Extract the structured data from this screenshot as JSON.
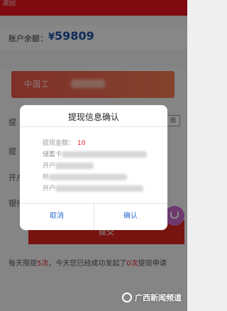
{
  "header": {
    "back_label": "返回"
  },
  "balance": {
    "label": "账户余额：",
    "currency": "¥",
    "amount": "59809"
  },
  "bank_card": {
    "bank_name": "中国工"
  },
  "form": {
    "label_1": "提",
    "label_2": "提",
    "label_3": "开户",
    "label_4": "银行",
    "badge": "图",
    "submit_label": "提交"
  },
  "limit_note": {
    "part1": "每天限提",
    "count_limit": "5次",
    "part2": "，今天您已经成功发起了",
    "count_done": "0次",
    "part3": "提现申请"
  },
  "dialog": {
    "title": "提现信息确认",
    "amount_label": "提现金额：",
    "amount_value": "10",
    "holder_label": "储蓄卡",
    "account_label": "开户",
    "branch_label": "所",
    "bank_label": "开户",
    "cancel_label": "取消",
    "confirm_label": "确认"
  },
  "watermark": {
    "text": "广西新闻频道"
  },
  "colors": {
    "brand_red": "#e8141e",
    "link_blue": "#2d6fd2",
    "balance_blue": "#1d4fa5"
  }
}
